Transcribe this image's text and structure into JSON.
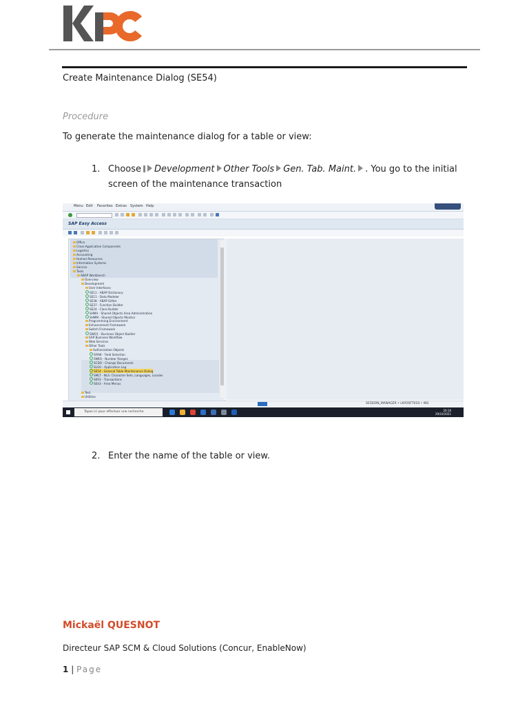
{
  "header": {
    "logo_text": "KPC"
  },
  "document": {
    "title": "Create Maintenance Dialog (SE54)",
    "procedure_heading": "Procedure",
    "intro": "To generate the maintenance dialog for a table or view:",
    "step1": {
      "number": "1.",
      "choose": "Choose",
      "path_1": "Development",
      "path_2": "Other Tools",
      "path_3": "Gen. Tab. Maint.",
      "line1_tail": ". You go to the initial",
      "line2": "screen of the maintenance transaction"
    },
    "step2": {
      "number": "2.",
      "text": "Enter the name of the table or view."
    }
  },
  "screenshot": {
    "menu": [
      "Menu",
      "Edit",
      "Favorites",
      "Extras",
      "System",
      "Help"
    ],
    "title": "SAP Easy Access",
    "tree": [
      "Office",
      "Cross-Application Components",
      "Logistics",
      "Accounting",
      "Human Resources",
      "Information Systems",
      "Service",
      "Tools",
      "ABAP Workbench",
      "Overview",
      "Development",
      "User Interfaces",
      "SE11 - ABAP Dictionary",
      "SE11 - Data Modeler",
      "SE38 - ABAP Editor",
      "SE37 - Function Builder",
      "SE24 - Class Builder",
      "SHMA - Shared Objects Area Administration",
      "SHMM - Shared Objects Monitor",
      "Programming Environment",
      "Enhancement Framework",
      "Switch Framework",
      "SWO1 - Business Object Builder",
      "SAP Business Workflow",
      "Web Services",
      "Other Tools",
      "Authorization Objects",
      "SFAW - Field Selection",
      "SNRO - Number Ranges",
      "SCDO - Change Documents",
      "SLG0 - Application Log",
      "SE54 - General Table Maintenance Dialog",
      "SMLT - NLS: Character Sets, Languages, Locales",
      "SE93 - Transactions",
      "SE43 - Area Menus",
      "Test",
      "Utilities"
    ],
    "status": "SESSION_MANAGER • LKYOSFT010 • INS",
    "search_placeholder": "Tapez ici pour effectuer une recherche",
    "clock_time": "20:16",
    "clock_date": "29/10/2021"
  },
  "author": {
    "name": "Mickaël QUESNOT",
    "role": "Directeur SAP SCM & Cloud Solutions (Concur, EnableNow)"
  },
  "footer": {
    "page_number": "1",
    "separator": "|",
    "page_word": "Page"
  },
  "colors": {
    "accent_orange": "#e8692a",
    "logo_gray": "#555555",
    "author_red": "#d24b2a"
  }
}
